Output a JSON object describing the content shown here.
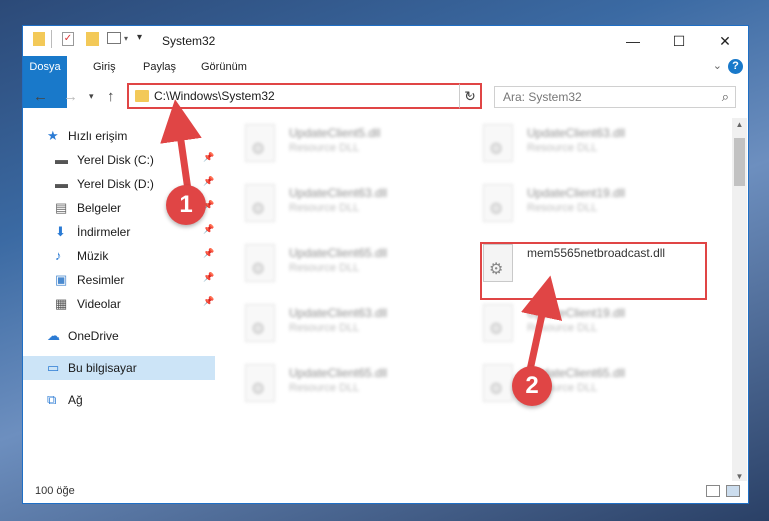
{
  "window": {
    "title": "System32",
    "controls": {
      "minimize": "—",
      "maximize": "☐",
      "close": "✕"
    }
  },
  "ribbon": {
    "tabs": [
      "Dosya",
      "Giriş",
      "Paylaş",
      "Görünüm"
    ],
    "help": "?"
  },
  "nav": {
    "address": "C:\\Windows\\System32",
    "search_placeholder": "Ara: System32"
  },
  "sidebar": {
    "items": [
      {
        "label": "Hızlı erişim",
        "icon": "star-icon",
        "pinned": false
      },
      {
        "label": "Yerel Disk (C:)",
        "icon": "drive-icon",
        "pinned": true
      },
      {
        "label": "Yerel Disk (D:)",
        "icon": "drive-icon",
        "pinned": true
      },
      {
        "label": "Belgeler",
        "icon": "documents-icon",
        "pinned": true
      },
      {
        "label": "İndirmeler",
        "icon": "download-icon",
        "pinned": true
      },
      {
        "label": "Müzik",
        "icon": "music-icon",
        "pinned": true
      },
      {
        "label": "Resimler",
        "icon": "pictures-icon",
        "pinned": true
      },
      {
        "label": "Videolar",
        "icon": "video-icon",
        "pinned": true
      },
      {
        "label": "OneDrive",
        "icon": "cloud-icon",
        "pinned": false
      },
      {
        "label": "Bu bilgisayar",
        "icon": "computer-icon",
        "pinned": false,
        "selected": true
      },
      {
        "label": "Ağ",
        "icon": "network-icon",
        "pinned": false
      }
    ]
  },
  "files": [
    {
      "name": "UpdateClient5.dll",
      "type": "Resource DLL",
      "blurred": true
    },
    {
      "name": "UpdateClient63.dll",
      "type": "Resource DLL",
      "blurred": true
    },
    {
      "name": "UpdateClient63.dll",
      "type": "Resource DLL",
      "blurred": true
    },
    {
      "name": "UpdateClient19.dll",
      "type": "Resource DLL",
      "blurred": true
    },
    {
      "name": "UpdateClient65.dll",
      "type": "Resource DLL",
      "blurred": true
    },
    {
      "name": "mem5565netbroadcast.dll",
      "type": "",
      "blurred": false
    },
    {
      "name": "UpdateClient63.dll",
      "type": "Resource DLL",
      "blurred": true
    },
    {
      "name": "UpdateClient19.dll",
      "type": "Resource DLL",
      "blurred": true
    },
    {
      "name": "UpdateClient65.dll",
      "type": "Resource DLL",
      "blurred": true
    },
    {
      "name": "UpdateClient65.dll",
      "type": "Resource DLL",
      "blurred": true
    }
  ],
  "status": {
    "count": "100 öğe"
  },
  "callouts": [
    "1",
    "2"
  ],
  "colors": {
    "accent": "#1979ca",
    "highlight": "#e04545",
    "selection": "#cce4f7"
  }
}
